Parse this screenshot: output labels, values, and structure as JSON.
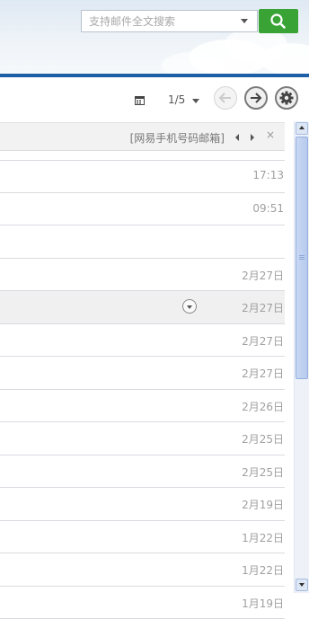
{
  "search": {
    "placeholder": "支持邮件全文搜索",
    "button_icon": "search-icon"
  },
  "toolbar": {
    "page_indicator": "1/5",
    "calendar_icon": "calendar-icon",
    "prev_icon": "arrow-left-icon",
    "next_icon": "arrow-right-icon",
    "settings_icon": "gear-icon"
  },
  "ad": {
    "text": "[网易手机号码邮箱]",
    "close": "×"
  },
  "mail_list": [
    {
      "date": "17:13"
    },
    {
      "date": "09:51"
    },
    {
      "date": ""
    },
    {
      "date": "2月27日"
    },
    {
      "date": "2月27日",
      "highlighted": true,
      "has_menu": true
    },
    {
      "date": "2月27日"
    },
    {
      "date": "2月27日"
    },
    {
      "date": "2月26日"
    },
    {
      "date": "2月25日"
    },
    {
      "date": "2月25日"
    },
    {
      "date": "2月19日"
    },
    {
      "date": "1月22日"
    },
    {
      "date": "1月22日"
    },
    {
      "date": "1月19日"
    }
  ],
  "colors": {
    "accent_line": "#1d5fa7",
    "search_button": "#3aa336",
    "scrollbar_thumb": "#b6caee"
  }
}
